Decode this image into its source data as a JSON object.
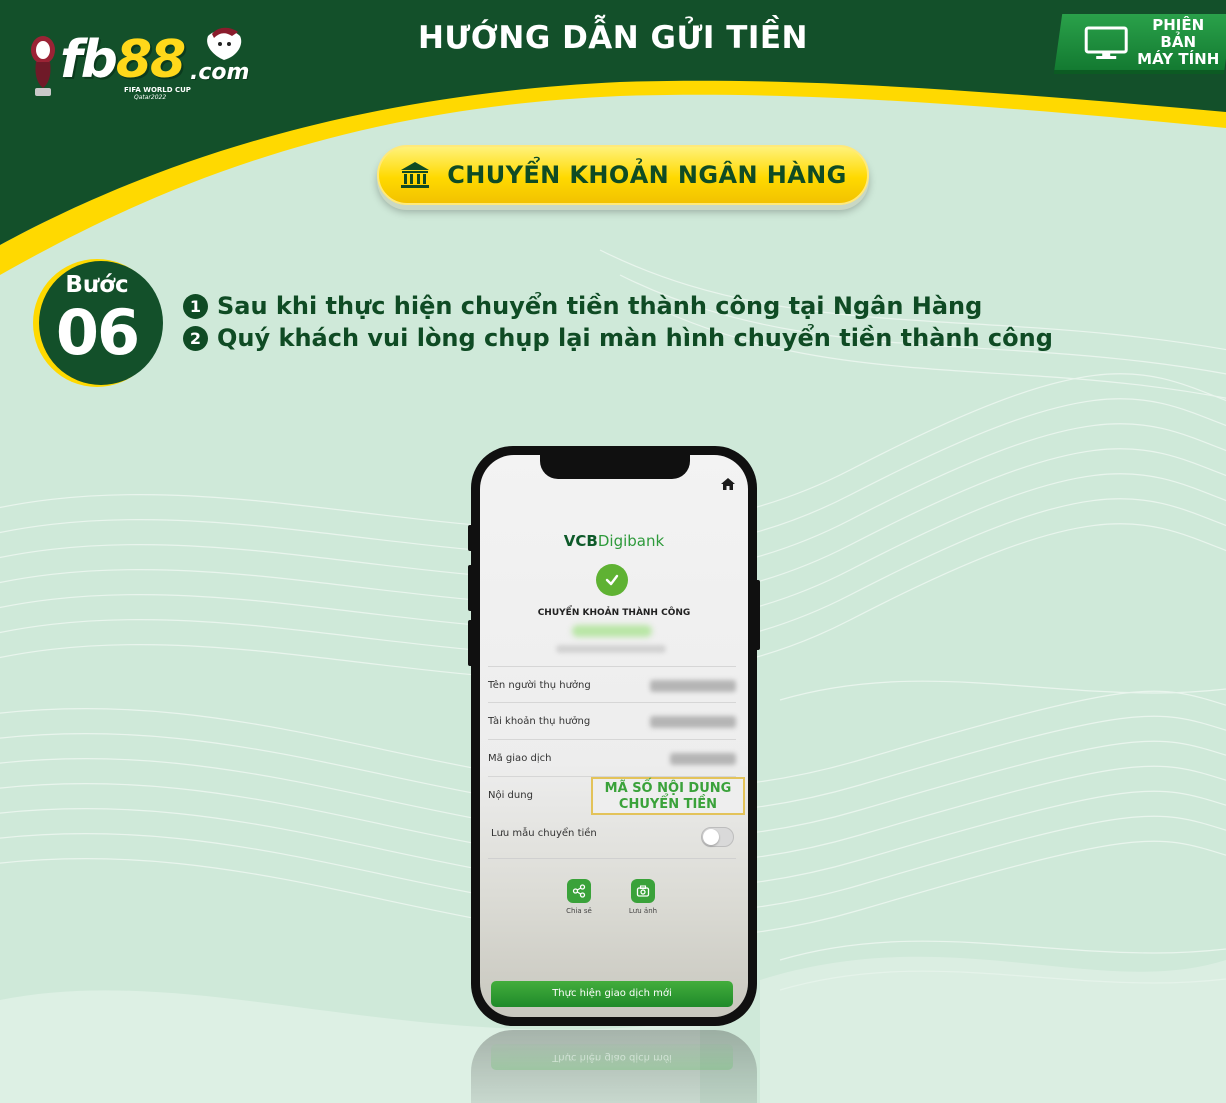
{
  "header": {
    "logo_brand": "fb88",
    "logo_brand_plain": "fb",
    "logo_brand_num": "88",
    "logo_domain": ".com",
    "logo_event": "FIFA WORLD CUP",
    "logo_event_sub": "Qatar2022",
    "title": "HƯỚNG DẪN GỬI TIỀN",
    "desktop_button": {
      "line1": "PHIÊN BẢN",
      "line2": "MÁY TÍNH",
      "icon": "monitor-icon"
    }
  },
  "method": {
    "label": "CHUYỂN KHOẢN NGÂN HÀNG",
    "icon": "bank-icon"
  },
  "step": {
    "word": "Bước",
    "number": "06",
    "instructions": [
      {
        "badge": "1",
        "text": "Sau khi thực hiện chuyển tiền thành công tại Ngân Hàng"
      },
      {
        "badge": "2",
        "text": "Quý khách vui lòng chụp lại màn hình chuyển tiền thành công"
      }
    ]
  },
  "phone": {
    "app_logo_a": "VCB",
    "app_logo_b": "Digibank",
    "success_title": "CHUYỂN KHOẢN THÀNH CÔNG",
    "rows": [
      {
        "label": "Tên người thụ hưởng"
      },
      {
        "label": "Tài khoản thụ hưởng"
      },
      {
        "label": "Mã giao dịch"
      },
      {
        "label": "Nội dung"
      }
    ],
    "content_highlight_line1": "MÃ SỐ NỘI DUNG",
    "content_highlight_line2": "CHUYỂN TIỀN",
    "save_template_label": "Lưu mẫu chuyển tiền",
    "save_template_on": false,
    "actions": [
      {
        "label": "Chia sẻ",
        "icon": "share-icon"
      },
      {
        "label": "Lưu ảnh",
        "icon": "camera-icon"
      }
    ],
    "new_transaction_button": "Thực hiện giao dịch mới"
  },
  "colors": {
    "header_green": "#13502a",
    "accent_yellow": "#ffd900",
    "background_mint": "#cfe9d9",
    "text_dark_green": "#0f4b24",
    "button_green": "#2e9a3b"
  }
}
